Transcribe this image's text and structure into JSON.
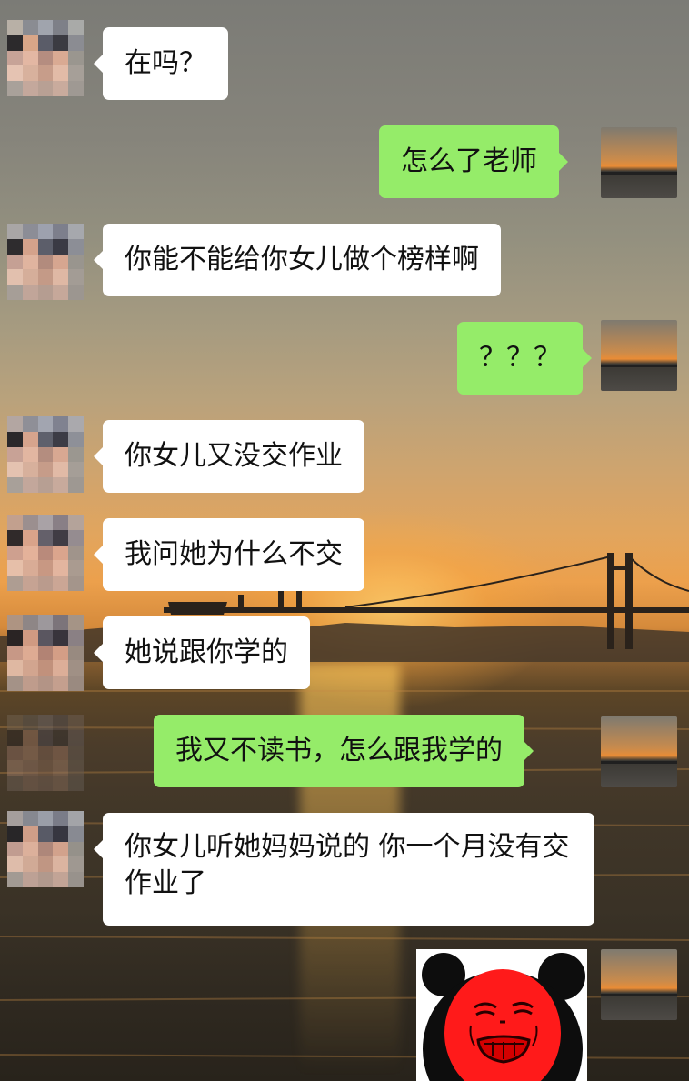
{
  "chat": {
    "messages": [
      {
        "side": "in",
        "text": "在吗？"
      },
      {
        "side": "out",
        "text": "怎么了老师"
      },
      {
        "side": "in",
        "text": "你能不能给你女儿做个榜样啊"
      },
      {
        "side": "out",
        "text": "？？？"
      },
      {
        "side": "in",
        "text": "你女儿又没交作业"
      },
      {
        "side": "in",
        "text": "我问她为什么不交"
      },
      {
        "side": "in",
        "text": "她说跟你学的"
      },
      {
        "side": "out",
        "text": "我又不读书，怎么跟我学的"
      },
      {
        "side": "in",
        "text": "你女儿听她妈妈说的 你一个月没有交作业了"
      },
      {
        "side": "out",
        "sticker": "red-panda-face-meme"
      }
    ]
  },
  "colors": {
    "incoming_bubble": "#ffffff",
    "outgoing_bubble": "#95ec69",
    "sticker_face": "#ff1a1a"
  },
  "icons": {
    "contact_avatar": "pixelated-avatar",
    "own_avatar": "sunset-avatar"
  }
}
